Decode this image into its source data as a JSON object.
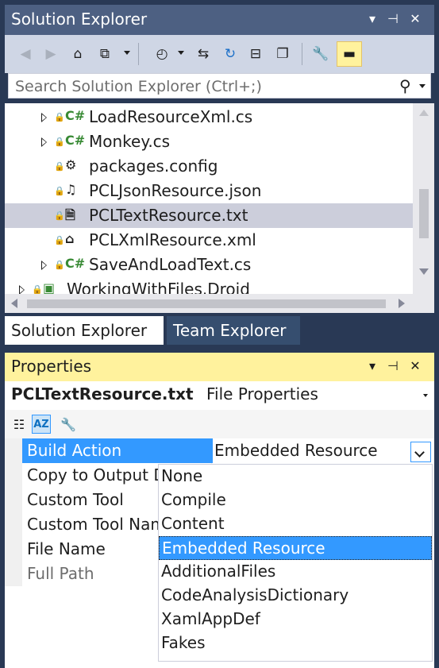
{
  "solution_explorer": {
    "title": "Solution Explorer",
    "search_placeholder": "Search Solution Explorer (Ctrl+;)",
    "tree": [
      {
        "label": "LoadResourceXml.cs",
        "icon": "csharp-file-icon",
        "expandable": true,
        "selected": false
      },
      {
        "label": "Monkey.cs",
        "icon": "csharp-file-icon",
        "expandable": true,
        "selected": false
      },
      {
        "label": "packages.config",
        "icon": "config-file-icon",
        "expandable": false,
        "selected": false
      },
      {
        "label": "PCLJsonResource.json",
        "icon": "json-file-icon",
        "expandable": false,
        "selected": false
      },
      {
        "label": "PCLTextResource.txt",
        "icon": "text-file-icon",
        "expandable": false,
        "selected": true
      },
      {
        "label": "PCLXmlResource.xml",
        "icon": "xml-file-icon",
        "expandable": false,
        "selected": false
      },
      {
        "label": "SaveAndLoadText.cs",
        "icon": "csharp-file-icon",
        "expandable": true,
        "selected": false
      },
      {
        "label": "WorkingWithFiles.Droid",
        "icon": "android-project-icon",
        "expandable": true,
        "selected": false
      }
    ],
    "tabs": [
      "Solution Explorer",
      "Team Explorer"
    ],
    "active_tab": "Solution Explorer"
  },
  "properties": {
    "title": "Properties",
    "object_name": "PCLTextResource.txt",
    "object_type": "File Properties",
    "rows": [
      {
        "name": "Build Action",
        "value": "Embedded Resource",
        "selected": true,
        "dim": false
      },
      {
        "name": "Copy to Output Directory",
        "value": "",
        "selected": false,
        "dim": false
      },
      {
        "name": "Custom Tool",
        "value": "",
        "selected": false,
        "dim": false
      },
      {
        "name": "Custom Tool Namespace",
        "value": "",
        "selected": false,
        "dim": false
      },
      {
        "name": "File Name",
        "value": "",
        "selected": false,
        "dim": false
      },
      {
        "name": "Full Path",
        "value": "",
        "selected": false,
        "dim": true
      }
    ],
    "build_action_options": [
      "None",
      "Compile",
      "Content",
      "Embedded Resource",
      "AdditionalFiles",
      "CodeAnalysisDictionary",
      "XamlAppDef",
      "Fakes"
    ],
    "build_action_selected": "Embedded Resource"
  },
  "colors": {
    "frame": "#293955",
    "title_inactive": "#4D6082",
    "title_active": "#FFF29D",
    "selection": "#3399FF"
  }
}
